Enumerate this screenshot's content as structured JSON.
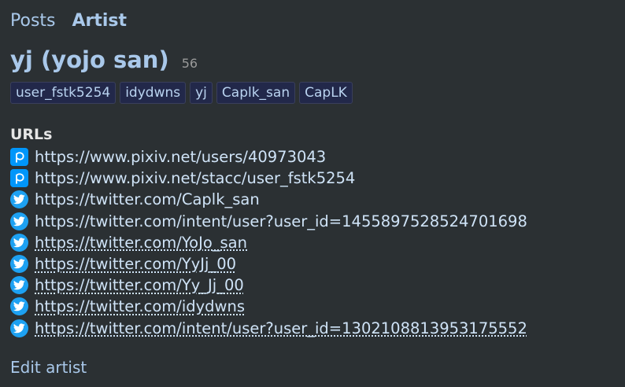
{
  "tabs": [
    {
      "label": "Posts",
      "active": false
    },
    {
      "label": "Artist",
      "active": true
    }
  ],
  "artist": {
    "name": "yj (yojo san)",
    "post_count": "56"
  },
  "aliases": [
    "user_fstk5254",
    "idydwns",
    "yj",
    "Caplk_san",
    "CapLK"
  ],
  "urls_heading": "URLs",
  "urls": [
    {
      "icon": "pixiv-icon",
      "site": "pixiv",
      "text": "https://www.pixiv.net/users/40973043",
      "active": true
    },
    {
      "icon": "pixiv-icon",
      "site": "pixiv",
      "text": "https://www.pixiv.net/stacc/user_fstk5254",
      "active": true
    },
    {
      "icon": "twitter-icon",
      "site": "twitter",
      "text": "https://twitter.com/Caplk_san",
      "active": true
    },
    {
      "icon": "twitter-icon",
      "site": "twitter",
      "text": "https://twitter.com/intent/user?user_id=1455897528524701698",
      "active": true
    },
    {
      "icon": "twitter-icon",
      "site": "twitter",
      "text": "https://twitter.com/YoJo_san",
      "active": false
    },
    {
      "icon": "twitter-icon",
      "site": "twitter",
      "text": "https://twitter.com/YyJj_00",
      "active": false
    },
    {
      "icon": "twitter-icon",
      "site": "twitter",
      "text": "https://twitter.com/Yy_Jj_00",
      "active": false
    },
    {
      "icon": "twitter-icon",
      "site": "twitter",
      "text": "https://twitter.com/idydwns",
      "active": false
    },
    {
      "icon": "twitter-icon",
      "site": "twitter",
      "text": "https://twitter.com/intent/user?user_id=1302108813953175552",
      "active": false
    }
  ],
  "edit_label": "Edit artist",
  "colors": {
    "background": "#2b3033",
    "link": "#a9c8ea",
    "pixiv": "#0096fa",
    "twitter": "#1da1f2"
  }
}
